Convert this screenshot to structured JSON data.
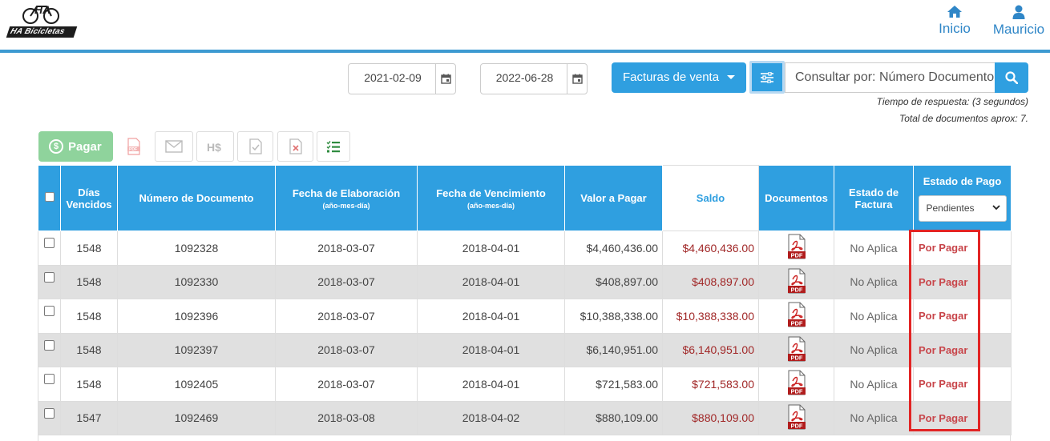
{
  "header": {
    "logo_text": "HA Bicicletas",
    "logo_monogram": "HA",
    "nav": [
      {
        "label": "Inicio",
        "icon": "home-icon"
      },
      {
        "label": "Mauricio",
        "icon": "user-icon"
      }
    ]
  },
  "filters": {
    "date_from": "2021-02-09",
    "date_to": "2022-06-28",
    "doc_type": "Facturas de venta",
    "search_placeholder": "Consultar por: Número Documento",
    "response_time": "Tiempo de respuesta: (3 segundos)",
    "total_docs": "Total de documentos aprox: 7."
  },
  "toolbar": {
    "pay_label": "Pagar",
    "icons": [
      "pdf-icon",
      "mail-icon",
      "h-dollar-icon",
      "doc-check-icon",
      "doc-x-icon",
      "checklist-icon"
    ]
  },
  "table": {
    "headers": {
      "days": "Días Vencidos",
      "doc": "Número de Documento",
      "elab": "Fecha de Elaboración",
      "elab_sub": "(año-mes-día)",
      "venc": "Fecha de Vencimiento",
      "venc_sub": "(año-mes-día)",
      "valor": "Valor a Pagar",
      "saldo": "Saldo",
      "docs": "Documentos",
      "estado_factura": "Estado de Factura",
      "estado_pago": "Estado de Pago",
      "estado_pago_filter": "Pendientes"
    },
    "rows": [
      {
        "days": "1548",
        "doc": "1092328",
        "elab": "2018-03-07",
        "venc": "2018-04-01",
        "valor": "$4,460,436.00",
        "saldo": "$4,460,436.00",
        "estado": "No Aplica",
        "pago": "Por Pagar"
      },
      {
        "days": "1548",
        "doc": "1092330",
        "elab": "2018-03-07",
        "venc": "2018-04-01",
        "valor": "$408,897.00",
        "saldo": "$408,897.00",
        "estado": "No Aplica",
        "pago": "Por Pagar"
      },
      {
        "days": "1548",
        "doc": "1092396",
        "elab": "2018-03-07",
        "venc": "2018-04-01",
        "valor": "$10,388,338.00",
        "saldo": "$10,388,338.00",
        "estado": "No Aplica",
        "pago": "Por Pagar"
      },
      {
        "days": "1548",
        "doc": "1092397",
        "elab": "2018-03-07",
        "venc": "2018-04-01",
        "valor": "$6,140,951.00",
        "saldo": "$6,140,951.00",
        "estado": "No Aplica",
        "pago": "Por Pagar"
      },
      {
        "days": "1548",
        "doc": "1092405",
        "elab": "2018-03-07",
        "venc": "2018-04-01",
        "valor": "$721,583.00",
        "saldo": "$721,583.00",
        "estado": "No Aplica",
        "pago": "Por Pagar"
      },
      {
        "days": "1547",
        "doc": "1092469",
        "elab": "2018-03-08",
        "venc": "2018-04-02",
        "valor": "$880,109.00",
        "saldo": "$880,109.00",
        "estado": "No Aplica",
        "pago": "Por Pagar"
      }
    ]
  },
  "colors": {
    "primary": "#2f9fe0",
    "pay_green": "#8fd39c",
    "saldo_red": "#a12828",
    "status_red": "#c8454a",
    "highlight": "#e22424"
  }
}
